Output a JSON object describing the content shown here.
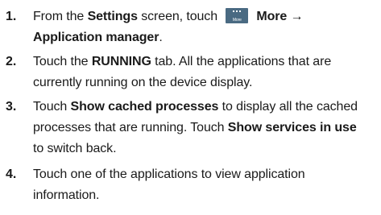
{
  "steps": [
    {
      "number": "1.",
      "lines": [
        [
          {
            "text": "From the ",
            "bold": false
          },
          {
            "text": "Settings",
            "bold": true
          },
          {
            "text": " screen, touch ",
            "bold": false
          },
          {
            "icon": "more-icon",
            "icon_label": "More"
          },
          {
            "text": "More →",
            "bold": true
          }
        ],
        [
          {
            "text": "Application manager",
            "bold": true
          },
          {
            "text": ".",
            "bold": false
          }
        ]
      ]
    },
    {
      "number": "2.",
      "lines": [
        [
          {
            "text": "Touch the ",
            "bold": false
          },
          {
            "text": "RUNNING",
            "bold": true
          },
          {
            "text": " tab. All the applications that are",
            "bold": false
          }
        ],
        [
          {
            "text": "currently running on the device display.",
            "bold": false
          }
        ]
      ]
    },
    {
      "number": "3.",
      "lines": [
        [
          {
            "text": "Touch ",
            "bold": false
          },
          {
            "text": "Show cached processes",
            "bold": true
          },
          {
            "text": " to display all the cached",
            "bold": false
          }
        ],
        [
          {
            "text": "processes that are running. Touch ",
            "bold": false
          },
          {
            "text": "Show services in use",
            "bold": true
          }
        ],
        [
          {
            "text": "to switch back.",
            "bold": false
          }
        ]
      ]
    },
    {
      "number": "4.",
      "lines": [
        [
          {
            "text": "Touch one of the applications to view application",
            "bold": false
          }
        ],
        [
          {
            "text": "information.",
            "bold": false
          }
        ]
      ]
    }
  ],
  "colors": {
    "text": "#1a1a1a",
    "icon_bg": "#4a6a82",
    "icon_fg": "#ffffff"
  }
}
